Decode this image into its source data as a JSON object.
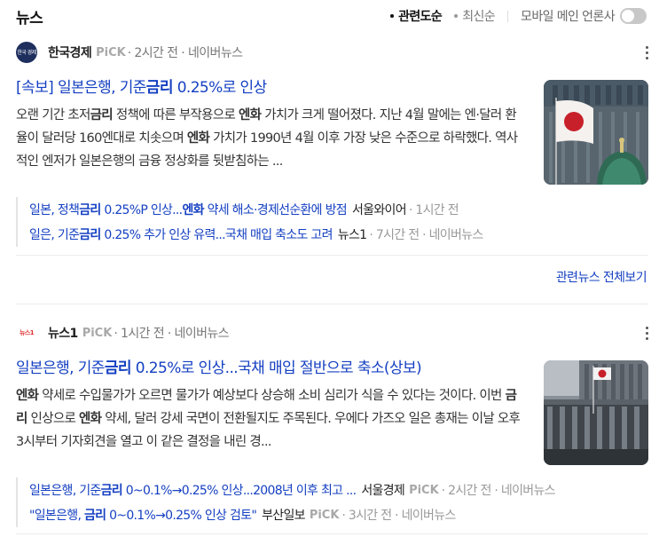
{
  "header": {
    "title": "뉴스",
    "sort_relevance": "관련도순",
    "sort_latest": "최신순",
    "mobile_press_label": "모바일 메인 언론사"
  },
  "articles": [
    {
      "press_logo_text": "한국 경제",
      "press": "한국경제",
      "pick": "PiCK",
      "meta": "· 2시간 전 · 네이버뉴스",
      "title_parts": [
        "[속보] 일본은행, 기준",
        "금리",
        " 0.25%로 인상"
      ],
      "summary": "오랜 기간 초저금리 정책에 따른 부작용으로 엔화 가치가 크게 떨어졌다. 지난 4월 말에는 엔·달러 환율이 달러당 160엔대로 치솟으며 엔화 가치가 1990년 4월 이후 가장 낮은 수준으로 하락했다. 역사적인 엔저가 일본은행의 금융 정상화를 뒷받침하는 ...",
      "thumb_icon": "japan-flag-building-photo",
      "related": [
        {
          "parts": [
            "일본, 정책",
            "금리",
            " 0.25%P 인상...",
            "엔화",
            " 약세 해소·경제선순환에 방점"
          ],
          "press": "서울와이어",
          "pick": "",
          "meta": "· 1시간 전"
        },
        {
          "parts": [
            "일은, 기준",
            "금리",
            " 0.25% 추가 인상 유력...국채 매입 축소도 고려"
          ],
          "press": "뉴스1",
          "pick": "",
          "meta": "· 7시간 전 · 네이버뉴스"
        }
      ]
    },
    {
      "press_logo_text": "뉴스1",
      "press": "뉴스1",
      "pick": "PiCK",
      "meta": "· 1시간 전 · 네이버뉴스",
      "title_parts": [
        "일본은행, 기준",
        "금리",
        " 0.25%로 인상...국채 매입 절반으로 축소(상보)"
      ],
      "summary": "엔화 약세로 수입물가가 오르면 물가가 예상보다 상승해 소비 심리가 식을 수 있다는 것이다. 이번 금리 인상으로 엔화 약세, 달러 강세 국면이 전환될지도 주목된다. 우에다 가즈오 일은 총재는 이날 오후 3시부터 기자회견을 열고 이 같은 결정을 내린 경...",
      "thumb_icon": "bank-of-japan-building-photo",
      "related": [
        {
          "parts": [
            "일본은행, 기준",
            "금리",
            " 0~0.1%→0.25% 인상...2008년 이후 최고 ..."
          ],
          "press": "서울경제",
          "pick": "PiCK",
          "meta": "· 2시간 전 · 네이버뉴스"
        },
        {
          "parts": [
            "\"일본은행, ",
            "금리",
            " 0~0.1%→0.25% 인상 검토\""
          ],
          "press": "부산일보",
          "pick": "PiCK",
          "meta": "· 3시간 전 · 네이버뉴스"
        }
      ]
    }
  ],
  "more_related_label": "관련뉴스 전체보기"
}
